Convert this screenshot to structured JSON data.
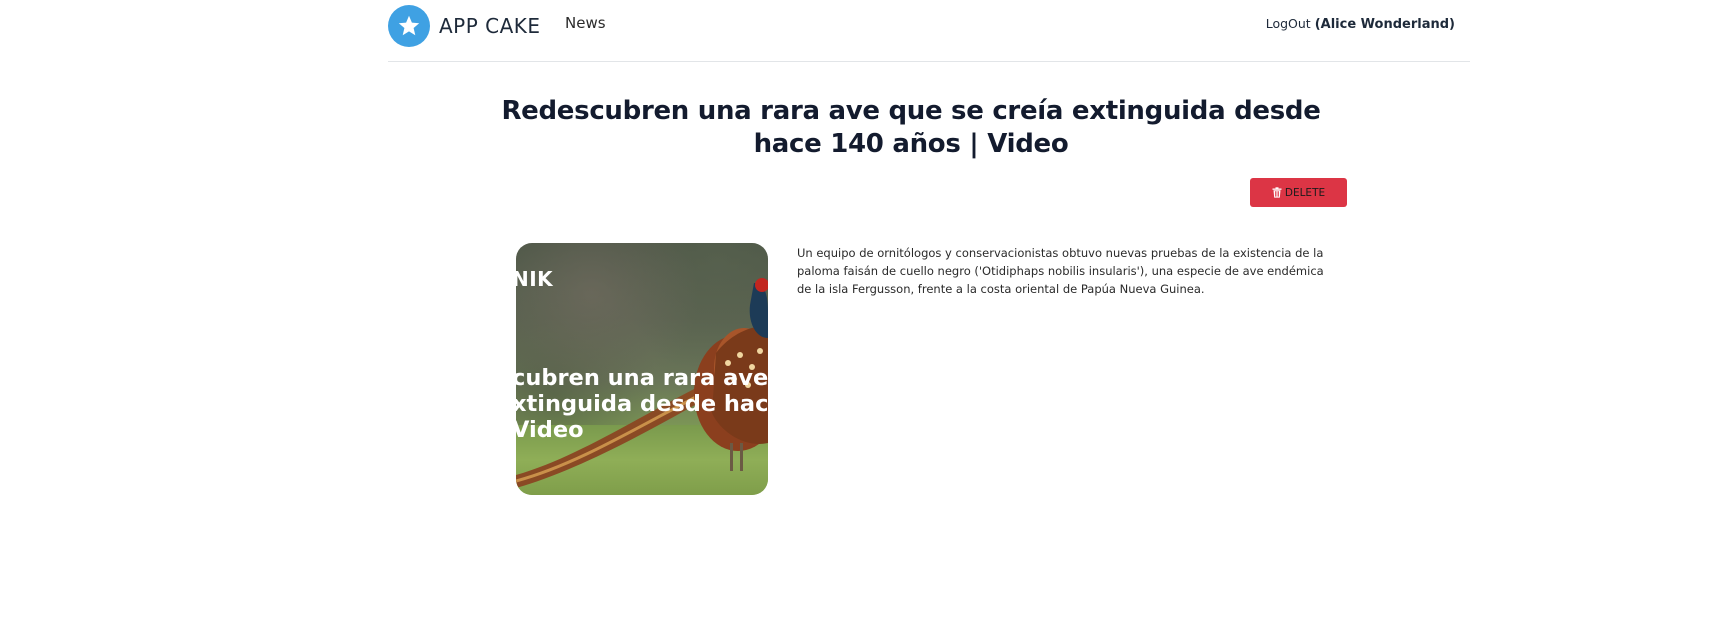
{
  "navbar": {
    "brand_name": "APP CAKE",
    "brand_icon": "star-icon",
    "brand_color": "#3fa1e3",
    "links": [
      {
        "label": "News"
      }
    ],
    "logout_label": "LogOut",
    "user_display": "(Alice Wonderland)"
  },
  "article": {
    "title": "Redescubren una rara ave que se creía extinguida desde hace 140 años | Video",
    "delete_label": "DELETE",
    "delete_icon": "trash-icon",
    "delete_color": "#dc3545",
    "body": "Un equipo de ornitólogos y conservacionistas obtuvo nuevas pruebas de la existencia de la paloma faisán de cuello negro ('Otidiphaps nobilis insularis'), una especie de ave endémica de la isla Fergusson, frente a la costa oriental de Papúa Nueva Guinea.",
    "image": {
      "brand_text": "NIK",
      "caption_lines": [
        "cubren una rara ave q",
        "xtinguida desde hace",
        "Video"
      ]
    }
  }
}
